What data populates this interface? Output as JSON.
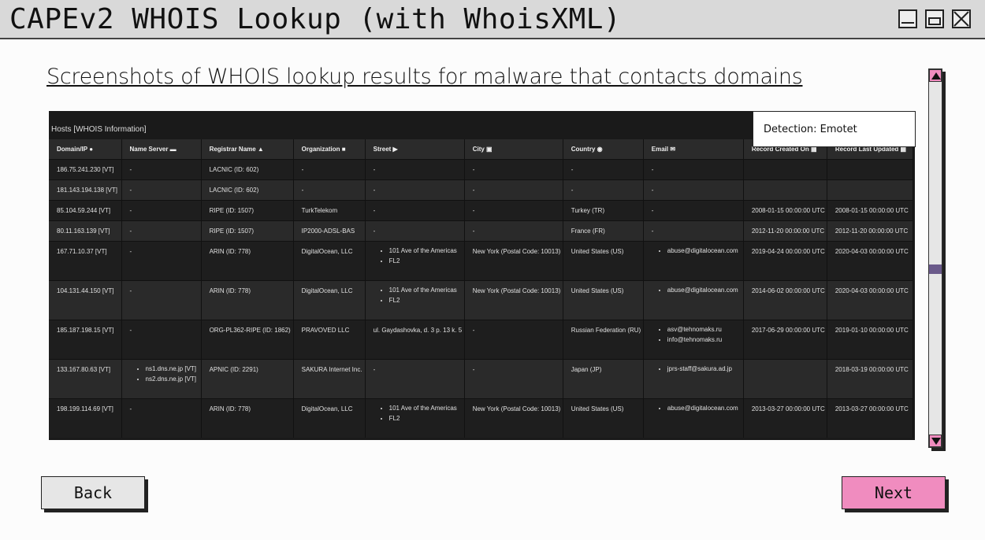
{
  "window": {
    "title": "CAPEv2 WHOIS Lookup (with WhoisXML)"
  },
  "heading": "Screenshots of WHOIS lookup results for malware that contacts domains",
  "screenshot": {
    "title": "Hosts [WHOIS Information]",
    "columns": [
      {
        "label": "Domain/IP",
        "icon": "map-marker-icon"
      },
      {
        "label": "Name Server",
        "icon": "server-icon"
      },
      {
        "label": "Registrar Name",
        "icon": "user-icon"
      },
      {
        "label": "Organization",
        "icon": "building-icon"
      },
      {
        "label": "Street",
        "icon": "flag-icon"
      },
      {
        "label": "City",
        "icon": "city-icon"
      },
      {
        "label": "Country",
        "icon": "globe-icon"
      },
      {
        "label": "Email",
        "icon": "envelope-icon"
      },
      {
        "label": "Record Created On",
        "icon": "calendar-icon"
      },
      {
        "label": "Record Last Updated",
        "icon": "calendar-icon"
      }
    ],
    "rows": [
      {
        "domain": "186.75.241.230 [VT]",
        "ns": "-",
        "registrar": "LACNIC (ID: 602)",
        "org": "-",
        "street": "-",
        "city": "-",
        "country": "-",
        "email": "-",
        "created": "",
        "updated": ""
      },
      {
        "domain": "181.143.194.138 [VT]",
        "ns": "-",
        "registrar": "LACNIC (ID: 602)",
        "org": "-",
        "street": "-",
        "city": "-",
        "country": "-",
        "email": "-",
        "created": "",
        "updated": ""
      },
      {
        "domain": "85.104.59.244 [VT]",
        "ns": "-",
        "registrar": "RIPE (ID: 1507)",
        "org": "TurkTelekom",
        "street": "-",
        "city": "-",
        "country": "Turkey (TR)",
        "email": "-",
        "created": "2008-01-15 00:00:00 UTC",
        "updated": "2008-01-15 00:00:00 UTC"
      },
      {
        "domain": "80.11.163.139 [VT]",
        "ns": "-",
        "registrar": "RIPE (ID: 1507)",
        "org": "IP2000-ADSL-BAS",
        "street": "-",
        "city": "-",
        "country": "France (FR)",
        "email": "-",
        "created": "2012-11-20 00:00:00 UTC",
        "updated": "2012-11-20 00:00:00 UTC"
      },
      {
        "domain": "167.71.10.37 [VT]",
        "ns": "-",
        "registrar": "ARIN (ID: 778)",
        "org": "DigitalOcean, LLC",
        "street": [
          "101 Ave of the Americas",
          "FL2"
        ],
        "city": "New York (Postal Code: 10013)",
        "country": "United States (US)",
        "email": [
          "abuse@digitalocean.com"
        ],
        "created": "2019-04-24 00:00:00 UTC",
        "updated": "2020-04-03 00:00:00 UTC"
      },
      {
        "domain": "104.131.44.150 [VT]",
        "ns": "-",
        "registrar": "ARIN (ID: 778)",
        "org": "DigitalOcean, LLC",
        "street": [
          "101 Ave of the Americas",
          "FL2"
        ],
        "city": "New York (Postal Code: 10013)",
        "country": "United States (US)",
        "email": [
          "abuse@digitalocean.com"
        ],
        "created": "2014-06-02 00:00:00 UTC",
        "updated": "2020-04-03 00:00:00 UTC"
      },
      {
        "domain": "185.187.198.15 [VT]",
        "ns": "-",
        "registrar": "ORG-PL362-RIPE (ID: 1862)",
        "org": "PRAVOVED LLC",
        "street": "ul. Gaydashovka, d. 3 p. 13 k. 5",
        "city": "-",
        "country": "Russian Federation (RU)",
        "email": [
          "asv@tehnomaks.ru",
          "info@tehnomaks.ru"
        ],
        "created": "2017-06-29 00:00:00 UTC",
        "updated": "2019-01-10 00:00:00 UTC"
      },
      {
        "domain": "133.167.80.63 [VT]",
        "ns": [
          "ns1.dns.ne.jp [VT]",
          "ns2.dns.ne.jp [VT]"
        ],
        "registrar": "APNIC (ID: 2291)",
        "org": "SAKURA Internet Inc.",
        "street": "-",
        "city": "-",
        "country": "Japan (JP)",
        "email": [
          "jprs-staff@sakura.ad.jp"
        ],
        "created": "",
        "updated": "2018-03-19 00:00:00 UTC"
      },
      {
        "domain": "198.199.114.69 [VT]",
        "ns": "-",
        "registrar": "ARIN (ID: 778)",
        "org": "DigitalOcean, LLC",
        "street": [
          "101 Ave of the Americas",
          "FL2"
        ],
        "city": "New York (Postal Code: 10013)",
        "country": "United States (US)",
        "email": [
          "abuse@digitalocean.com"
        ],
        "created": "2013-03-27 00:00:00 UTC",
        "updated": "2013-03-27 00:00:00 UTC"
      }
    ]
  },
  "tooltip": "Detection: Emotet",
  "buttons": {
    "back": "Back",
    "next": "Next"
  },
  "colors": {
    "accent": "#f08cbf",
    "titlebar": "#d9d9d9",
    "table_bg": "#1a1a1a"
  }
}
